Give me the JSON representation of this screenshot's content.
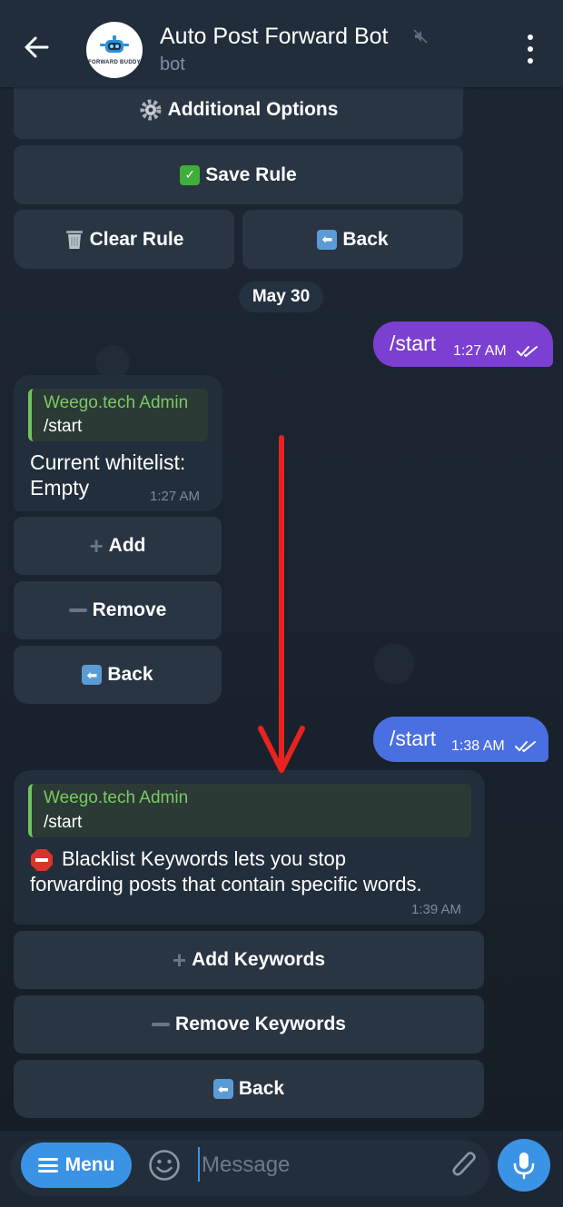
{
  "header": {
    "title": "Auto Post Forward Bot",
    "subtitle": "bot",
    "avatar_brand": "FORWARD BUDDY"
  },
  "top_keyboard": {
    "additional_options": "Additional Options",
    "save_rule": "Save Rule",
    "clear_rule": "Clear Rule",
    "back": "Back"
  },
  "date_separator": "May 30",
  "outgoing_1": {
    "text": "/start",
    "time": "1:27 AM"
  },
  "incoming_1": {
    "reply_name": "Weego.tech Admin",
    "reply_text": "/start",
    "text_line1": "Current whitelist:",
    "text_line2": "Empty",
    "time": "1:27 AM",
    "buttons": {
      "add": "Add",
      "remove": "Remove",
      "back": "Back"
    }
  },
  "outgoing_2": {
    "text": "/start",
    "time": "1:38 AM"
  },
  "incoming_2": {
    "reply_name": "Weego.tech Admin",
    "reply_text": "/start",
    "text_line1": "Blacklist Keywords lets you stop",
    "text_line2": "forwarding posts that contain specific words.",
    "time": "1:39 AM",
    "buttons": {
      "add_keywords": "Add Keywords",
      "remove_keywords": "Remove Keywords",
      "back": "Back"
    }
  },
  "composer": {
    "menu_label": "Menu",
    "placeholder": "Message"
  },
  "colors": {
    "header_bg": "#212d3b",
    "accent_blue": "#3b93e6",
    "outgoing_purple": "#7b3fd1",
    "outgoing_blue": "#4a6fe0",
    "reply_name_green": "#7ac963",
    "annotation_red": "#e8231f"
  },
  "icons": [
    "back-arrow-icon",
    "mute-icon",
    "more-vert-icon",
    "gear-icon",
    "check-mark-icon",
    "wastebasket-icon",
    "left-arrow-emoji-icon",
    "plus-icon",
    "minus-icon",
    "stop-sign-icon",
    "double-check-icon",
    "smile-icon",
    "paperclip-icon",
    "microphone-icon"
  ]
}
